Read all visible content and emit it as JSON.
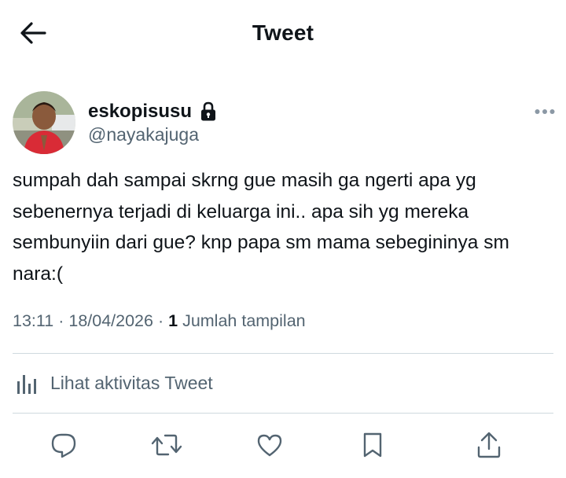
{
  "header": {
    "title": "Tweet",
    "back_icon": "arrow-left-icon"
  },
  "author": {
    "display_name": "eskopisusu",
    "handle": "@nayakajuga",
    "protected_icon": "lock-icon",
    "more_icon": "more-horizontal-icon"
  },
  "tweet": {
    "text": "sumpah dah sampai skrng gue masih ga ngerti apa yg sebenernya terjadi di keluarga ini.. apa sih yg mereka sembunyiin dari gue? knp papa sm mama sebegininya sm nara:(",
    "time": "13:11",
    "separator": "·",
    "date": "18/04/2026",
    "views_count": "1",
    "views_label": "Jumlah tampilan"
  },
  "activity": {
    "label": "Lihat aktivitas Tweet",
    "icon": "analytics-bar-icon"
  },
  "actions": [
    {
      "name": "reply",
      "icon": "reply-icon"
    },
    {
      "name": "retweet",
      "icon": "retweet-icon"
    },
    {
      "name": "like",
      "icon": "heart-icon"
    },
    {
      "name": "bookmark",
      "icon": "bookmark-icon"
    },
    {
      "name": "share",
      "icon": "share-icon"
    }
  ],
  "colors": {
    "primary_text": "#0f1419",
    "secondary_text": "#536471",
    "divider": "#cfd9de"
  }
}
